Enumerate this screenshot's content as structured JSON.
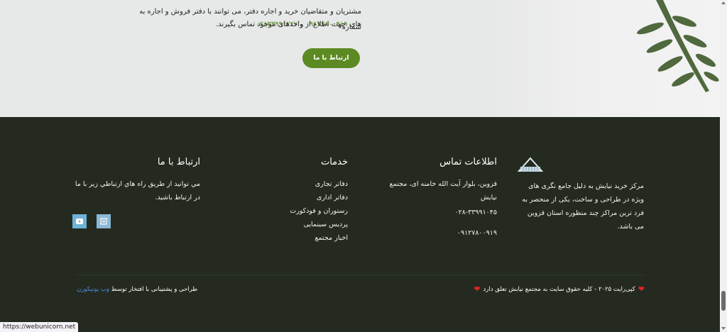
{
  "cta": {
    "line1": "مشتریان و متقاضیان خرید و اجاره دفتر، می توانند با دفتر فروش و اجاره به شماره",
    "line2_prefix": "های",
    "phone1": "۰۹۱۲۷۸۰۰۹۱۹",
    "and": "و",
    "phone2": "۰۲۸۳۳۹۹۱۲۲۷",
    "line2_suffix": "جهت اطلاع از واحدهای موجود تماس بگیرند.",
    "button": "ارتباط با ما"
  },
  "footer": {
    "about": {
      "text": "مرکز خرید نیایش به دلیل جامع نگری های ویژه در طراحی و ساخت، یکی از منحصر به فرد ترین مراکز چند منظوره استان قزوین می باشد."
    },
    "contact": {
      "title": "اطلاعات تماس",
      "address": "قزوین، بلوار آیت الله خامنه ای، مجتمع نیایش",
      "phone1": "۰۲۸-۳۳۹۹۱۰۴۵",
      "phone2": "۰۹۱۲۷۸۰۰۹۱۹"
    },
    "services": {
      "title": "خدمات",
      "items": [
        "دفاتر تجاری",
        "دفاتر اداری",
        "رستوران و فودکورت",
        "پردیس سینمایی",
        "اخبار مجتمع"
      ]
    },
    "reach": {
      "title": "ارتباط با ما",
      "text": "مي توانيد از طريق راه هاي ارتباطي زير با ما در ارتباط باشید."
    },
    "copyright": "کپی‌رایت ۲۰۲۵ - کلیه حقوق سایت به مجتمع نیایش تعلق دارد",
    "designer_prefix": "طراحی و پشتیبانی با افتخار توسط",
    "designer_link": "وب یونیکورن"
  },
  "status_url": "https://webunicorn.net",
  "colors": {
    "accent": "#5c8a22",
    "footer_bg": "#242a1f",
    "link": "#4b8cf0"
  }
}
